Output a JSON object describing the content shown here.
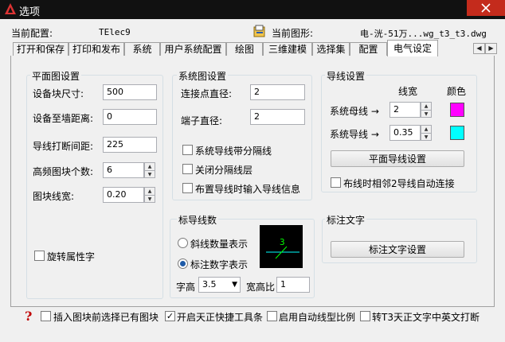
{
  "window": {
    "title": "选项"
  },
  "header": {
    "current_config_label": "当前配置:",
    "current_config_value": "TElec9",
    "current_drawing_label": "当前图形:",
    "current_drawing_value": "电-洸-51万...wg_t3_t3.dwg"
  },
  "tabs": [
    "打开和保存",
    "打印和发布",
    "系统",
    "用户系统配置",
    "绘图",
    "三维建模",
    "选择集",
    "配置",
    "电气设定"
  ],
  "active_tab": "电气设定",
  "plan": {
    "title": "平面图设置",
    "block_size_label": "设备块尺寸:",
    "block_size": "500",
    "wall_dist_label": "设备至墙距离:",
    "wall_dist": "0",
    "wire_gap_label": "导线打断间距:",
    "wire_gap": "225",
    "hf_count_label": "高频图块个数:",
    "hf_count": "6",
    "line_width_label": "图块线宽:",
    "line_width": "0.20",
    "rotate_attr_label": "旋转属性字",
    "rotate_attr": false
  },
  "system": {
    "title": "系统图设置",
    "node_dia_label": "连接点直径:",
    "node_dia": "2",
    "terminal_dia_label": "端子直径:",
    "terminal_dia": "2",
    "opt1_label": "系统导线带分隔线",
    "opt1": false,
    "opt2_label": "关闭分隔线层",
    "opt2": false,
    "opt3_label": "布置导线时输入导线信息",
    "opt3": false
  },
  "wire": {
    "title": "导线设置",
    "width_header": "线宽",
    "color_header": "颜色",
    "bus_label": "系统母线 →",
    "bus_width": "2",
    "bus_color": "#ff00ff",
    "wire_label": "系统导线 →",
    "wire_width": "0.35",
    "wire_color": "#00ffff",
    "plan_button": "平面导线设置",
    "auto_connect_label": "布线时相邻2导线自动连接",
    "auto_connect": false
  },
  "count": {
    "title": "标导线数",
    "radio1_label": "斜线数量表示",
    "radio2_label": "标注数字表示",
    "selected": 2,
    "preview_number": "3",
    "text_height_label": "字高",
    "text_height": "3.5",
    "ratio_label": "宽高比",
    "ratio": "1"
  },
  "annot": {
    "title": "标注文字",
    "button": "标注文字设置"
  },
  "bottom": {
    "opt1_label": "插入图块前选择已有图块",
    "opt1": false,
    "opt2_label": "开启天正快捷工具条",
    "opt2": true,
    "opt3_label": "启用自动线型比例",
    "opt3": false,
    "opt4_label": "转T3天正文字中英文打断",
    "opt4": false
  },
  "colors": {
    "accent": "#1e5ba8",
    "titlebar": "#111111",
    "close": "#c42b1c"
  }
}
